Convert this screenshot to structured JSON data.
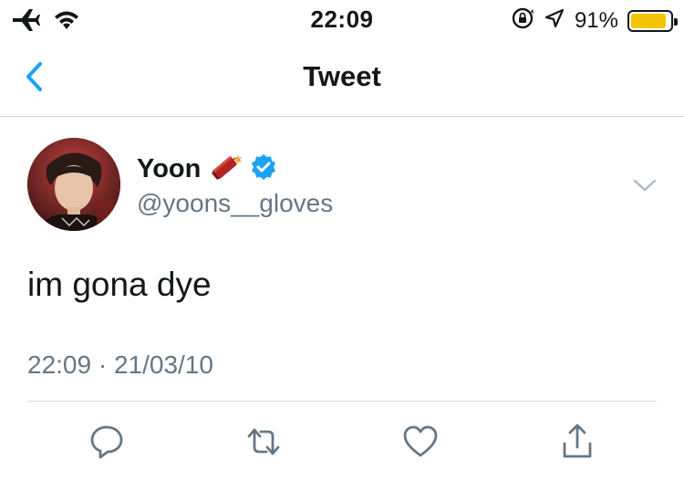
{
  "status_bar": {
    "time": "22:09",
    "battery_percent_label": "91%",
    "battery_level": 0.91,
    "battery_color": "#f5c400",
    "icons": [
      "airplane-icon",
      "wifi-icon",
      "orientation-lock-icon",
      "location-arrow-icon",
      "battery-icon"
    ]
  },
  "nav": {
    "title": "Tweet",
    "back_icon": "chevron-left-icon"
  },
  "tweet": {
    "author_name": "Yoon",
    "author_handle": "@yoons__gloves",
    "name_emoji": "firecracker-icon",
    "verified": true,
    "text": "im gona dye",
    "timestamp": "22:09 · 21/03/10"
  },
  "actions": [
    {
      "name": "reply-icon"
    },
    {
      "name": "retweet-icon"
    },
    {
      "name": "like-icon"
    },
    {
      "name": "share-icon"
    }
  ],
  "colors": {
    "accent": "#1da1f2",
    "text": "#14171a",
    "secondary_text": "#657786",
    "divider": "#d6dbdf"
  }
}
